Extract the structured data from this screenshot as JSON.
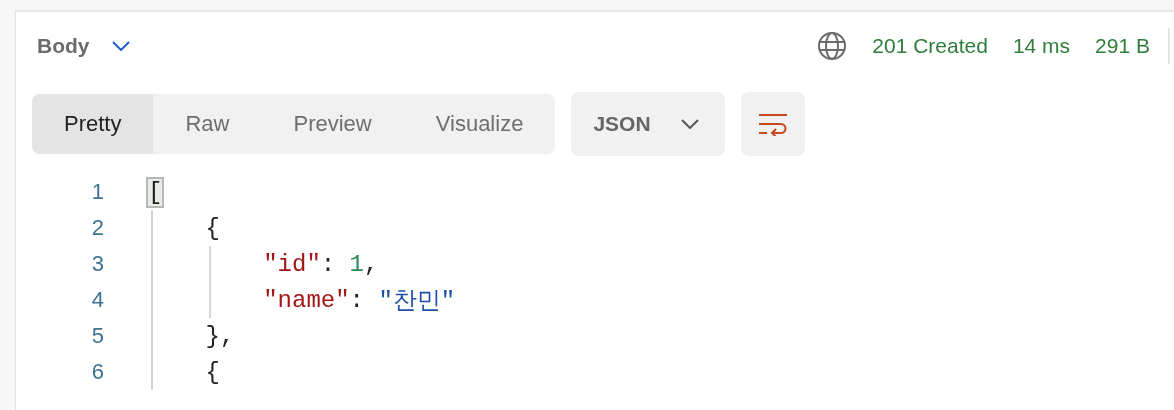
{
  "response_header": {
    "section": "Body",
    "status": "201 Created",
    "time": "14 ms",
    "size": "291 B"
  },
  "view_tabs": [
    {
      "label": "Pretty",
      "selected": true
    },
    {
      "label": "Raw",
      "selected": false
    },
    {
      "label": "Preview",
      "selected": false
    },
    {
      "label": "Visualize",
      "selected": false
    }
  ],
  "format_dropdown": {
    "value": "JSON"
  },
  "code_lines": [
    {
      "number": "1",
      "tokens": [
        {
          "kind": "bracket",
          "text": "[",
          "matched": true
        }
      ],
      "children": [
        {
          "number": "2",
          "tokens": [
            {
              "kind": "punct",
              "text": "{"
            }
          ],
          "children": [
            {
              "number": "3",
              "tokens": [
                {
                  "kind": "key",
                  "text": "\"id\""
                },
                {
                  "kind": "punct",
                  "text": ": "
                },
                {
                  "kind": "number",
                  "text": "1"
                },
                {
                  "kind": "punct",
                  "text": ","
                }
              ]
            },
            {
              "number": "4",
              "tokens": [
                {
                  "kind": "key",
                  "text": "\"name\""
                },
                {
                  "kind": "punct",
                  "text": ": "
                },
                {
                  "kind": "string",
                  "text": "\"찬민\""
                }
              ]
            }
          ]
        },
        {
          "number": "5",
          "tokens": [
            {
              "kind": "punct",
              "text": "},"
            }
          ]
        },
        {
          "number": "6",
          "tokens": [
            {
              "kind": "punct",
              "text": "{"
            }
          ]
        }
      ]
    }
  ]
}
